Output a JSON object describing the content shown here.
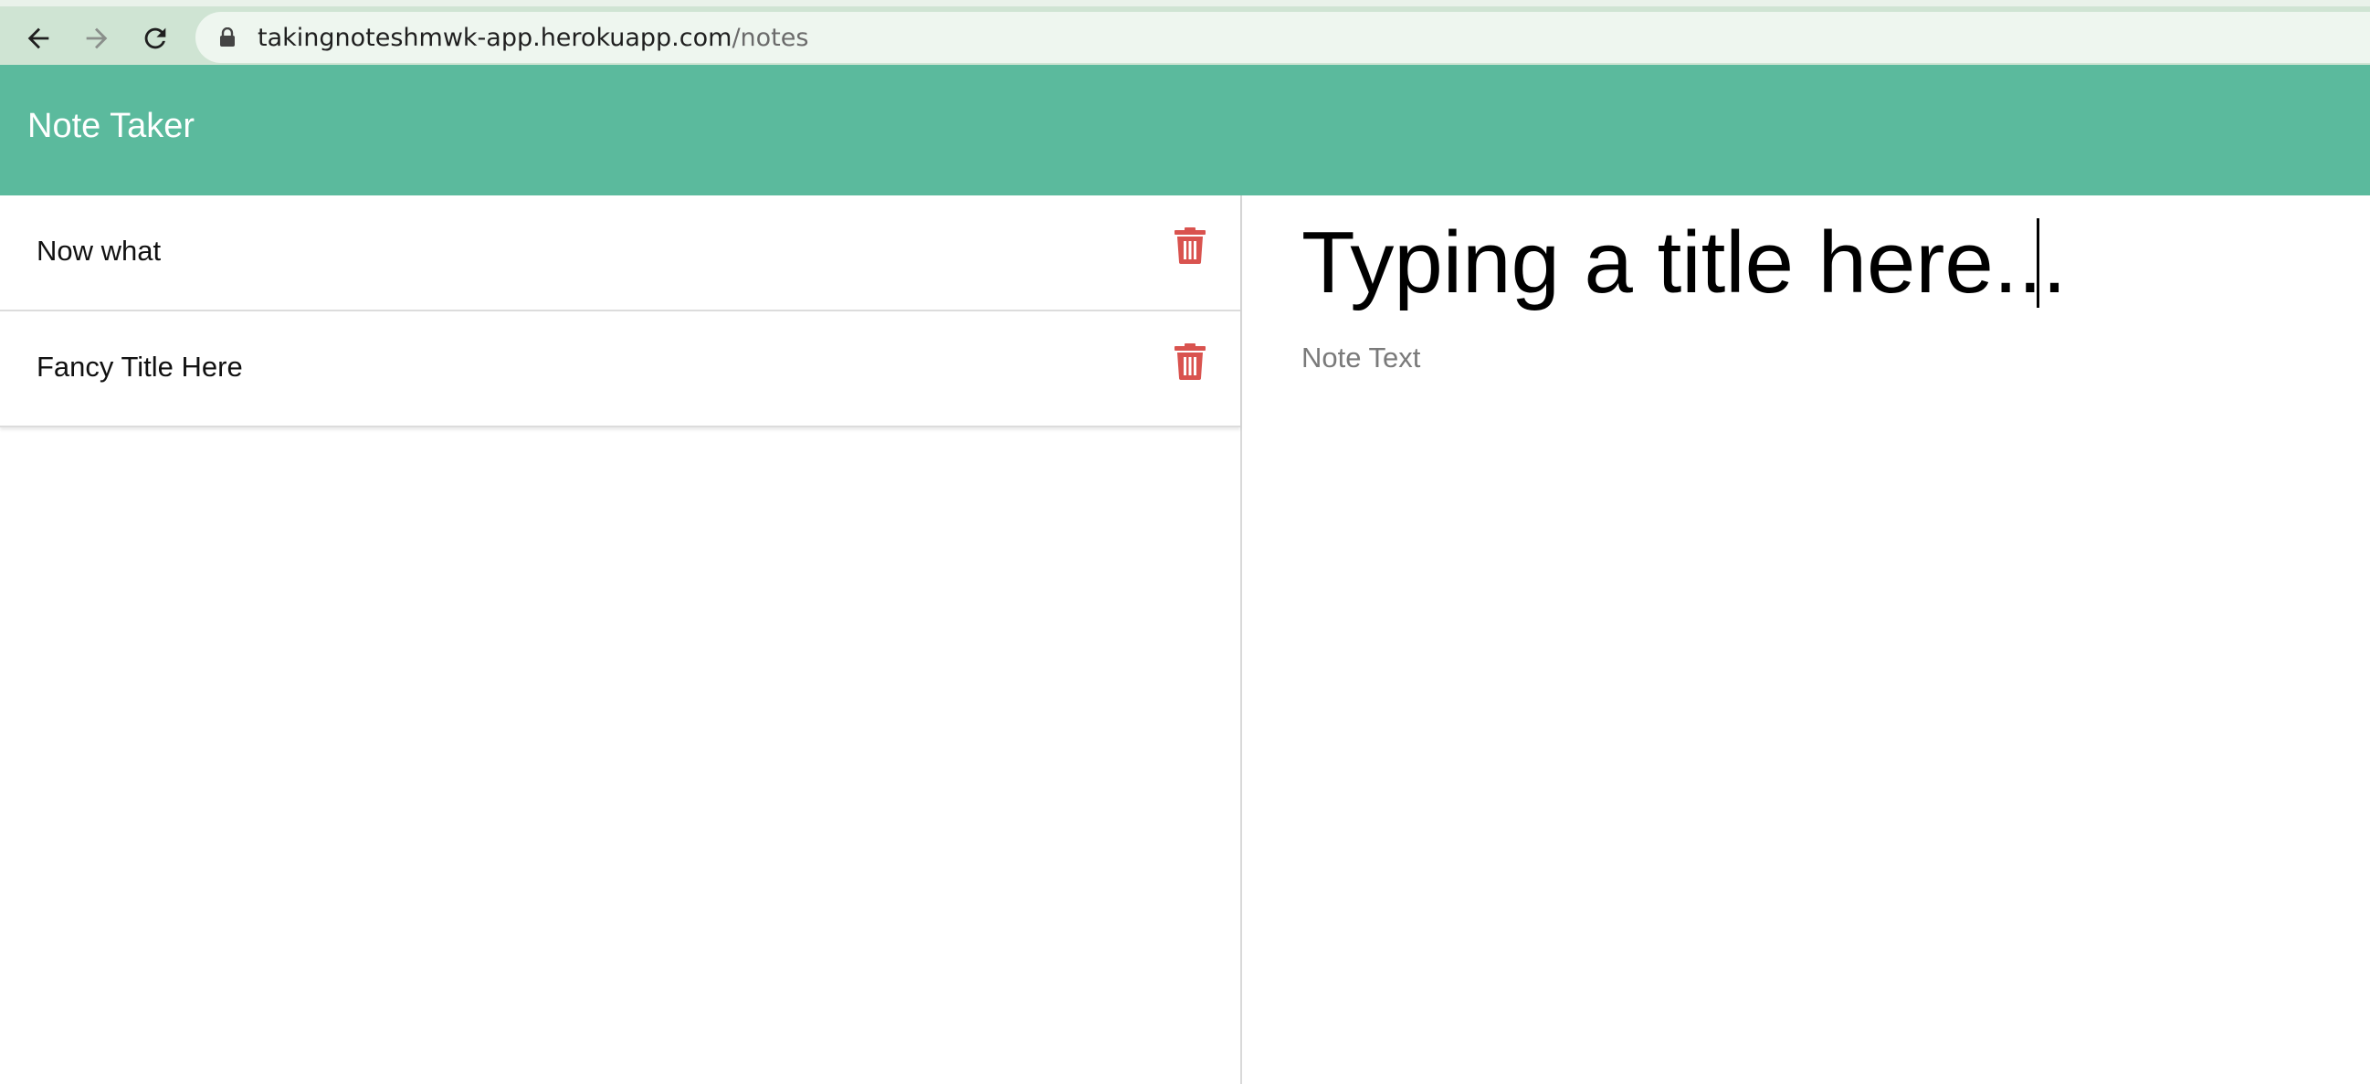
{
  "browser": {
    "url_host": "takingnoteshmwk-app.herokuapp.com",
    "url_path": "/notes",
    "back_icon": "arrow-left-icon",
    "forward_icon": "arrow-right-icon",
    "reload_icon": "reload-icon",
    "lock_icon": "lock-icon"
  },
  "header": {
    "title": "Note Taker",
    "background_color": "#5bba9d"
  },
  "notes": [
    {
      "title": "Now what",
      "delete_icon": "trash-icon"
    },
    {
      "title": "Fancy Title Here",
      "delete_icon": "trash-icon"
    }
  ],
  "editor": {
    "title_value": "Typing a title here...",
    "text_placeholder": "Note Text"
  },
  "colors": {
    "delete_icon": "#d9534f"
  }
}
